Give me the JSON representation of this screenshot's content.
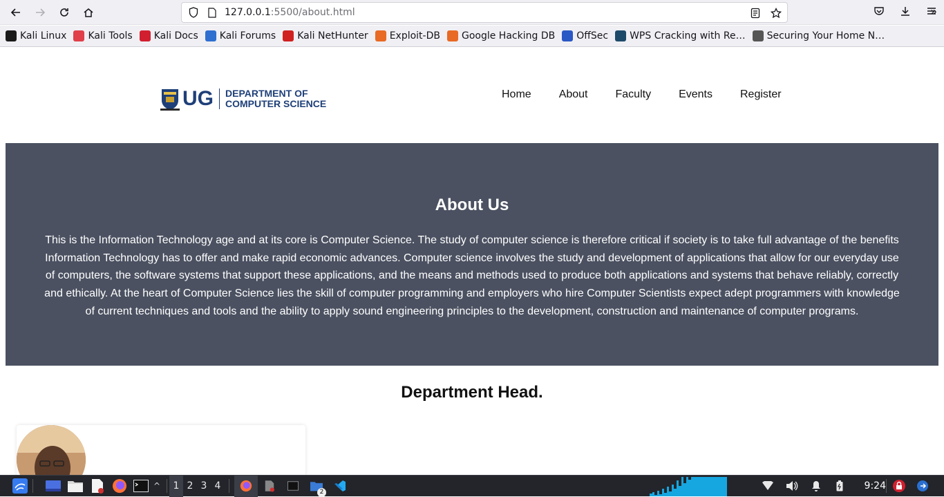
{
  "browser": {
    "url_host": "127.0.0.1",
    "url_rest": ":5500/about.html",
    "bookmarks": [
      {
        "label": "Kali Linux",
        "color": "#1a1a1a"
      },
      {
        "label": "Kali Tools",
        "color": "#e0404a"
      },
      {
        "label": "Kali Docs",
        "color": "#d21f2f"
      },
      {
        "label": "Kali Forums",
        "color": "#2f6fd0"
      },
      {
        "label": "Kali NetHunter",
        "color": "#d02020"
      },
      {
        "label": "Exploit-DB",
        "color": "#e86a24"
      },
      {
        "label": "Google Hacking DB",
        "color": "#e86a24"
      },
      {
        "label": "OffSec",
        "color": "#2a58c4"
      },
      {
        "label": "WPS Cracking with Re…",
        "color": "#1e4a6a"
      },
      {
        "label": "Securing Your Home N…",
        "color": "#555555"
      }
    ]
  },
  "site": {
    "logo_ug": "UG",
    "logo_line1": "DEPARTMENT OF",
    "logo_line2": "COMPUTER SCIENCE",
    "nav": [
      "Home",
      "About",
      "Faculty",
      "Events",
      "Register"
    ],
    "about_title": "About Us",
    "about_text": "This is the Information Technology age and at its core is Computer Science. The study of computer science is therefore critical if society is to take full advantage of the benefits Information Technology has to offer and make rapid economic advances. Computer science involves the study and development of applications that allow for our everyday use of computers, the software systems that support these applications, and the means and methods used to produce both applications and systems that behave reliably, correctly and ethically. At the heart of Computer Science lies the skill of computer programming and employers who hire Computer Scientists expect adept programmers with knowledge of current techniques and tools and the ability to apply sound engineering principles to the development, construction and maintenance of computer programs.",
    "head_title": "Department Head."
  },
  "taskbar": {
    "workspaces": [
      "1",
      "2",
      "3",
      "4"
    ],
    "clock": "9:24",
    "badge": "2"
  },
  "colors": {
    "brand_blue": "#1e3f78",
    "about_bg": "#4b5161"
  }
}
